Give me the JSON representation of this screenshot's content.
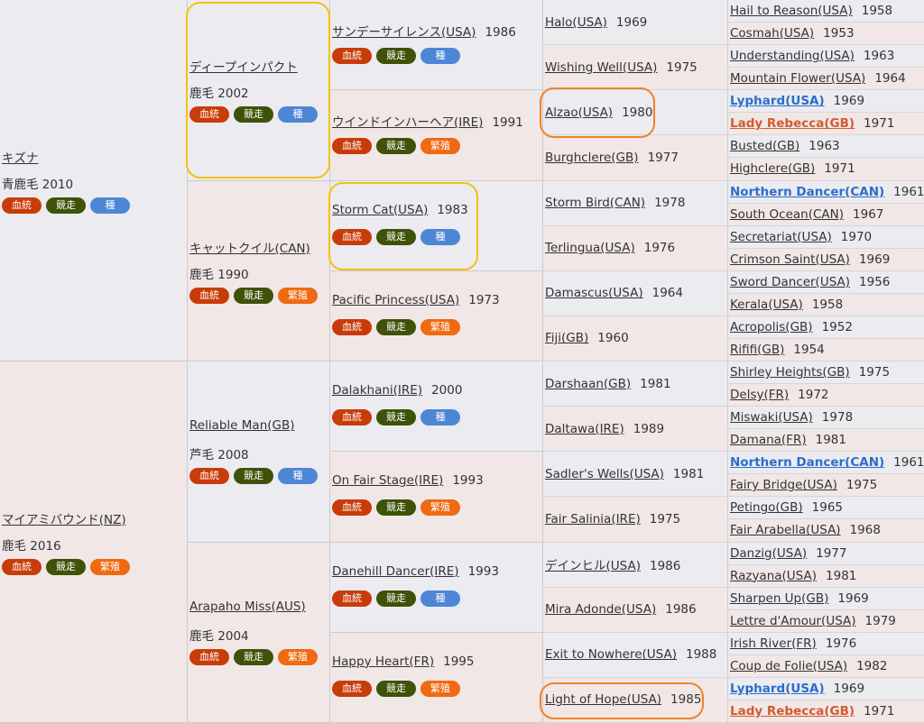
{
  "badge_labels": {
    "blood": "血統",
    "race": "競走",
    "sire": "種",
    "breed": "繁殖"
  },
  "gen1": [
    {
      "name": "キズナ",
      "coat": "青鹿毛 2010",
      "badges": [
        "blood",
        "race",
        "sire"
      ],
      "sex": "male"
    },
    {
      "name": "マイアミバウンド(NZ)",
      "coat": "鹿毛 2016",
      "badges": [
        "blood",
        "race",
        "breed"
      ],
      "sex": "female"
    }
  ],
  "gen2": [
    {
      "name": "ディープインパクト",
      "coat": "鹿毛 2002",
      "badges": [
        "blood",
        "race",
        "sire"
      ],
      "sex": "male"
    },
    {
      "name": "キャットクイル(CAN)",
      "coat": "鹿毛 1990",
      "badges": [
        "blood",
        "race",
        "breed"
      ],
      "sex": "female"
    },
    {
      "name": "Reliable Man(GB)",
      "coat": "芦毛 2008",
      "badges": [
        "blood",
        "race",
        "sire"
      ],
      "sex": "male"
    },
    {
      "name": "Arapaho Miss(AUS)",
      "coat": "鹿毛 2004",
      "badges": [
        "blood",
        "race",
        "breed"
      ],
      "sex": "female"
    }
  ],
  "gen3": [
    {
      "name": "サンデーサイレンス(USA)",
      "year": "1986",
      "badges": [
        "blood",
        "race",
        "sire"
      ],
      "sex": "male"
    },
    {
      "name": "ウインドインハーヘア(IRE)",
      "year": "1991",
      "badges": [
        "blood",
        "race",
        "breed"
      ],
      "sex": "female"
    },
    {
      "name": "Storm Cat(USA)",
      "year": "1983",
      "badges": [
        "blood",
        "race",
        "sire"
      ],
      "sex": "male"
    },
    {
      "name": "Pacific Princess(USA)",
      "year": "1973",
      "badges": [
        "blood",
        "race",
        "breed"
      ],
      "sex": "female"
    },
    {
      "name": "Dalakhani(IRE)",
      "year": "2000",
      "badges": [
        "blood",
        "race",
        "sire"
      ],
      "sex": "male"
    },
    {
      "name": "On Fair Stage(IRE)",
      "year": "1993",
      "badges": [
        "blood",
        "race",
        "breed"
      ],
      "sex": "female"
    },
    {
      "name": "Danehill Dancer(IRE)",
      "year": "1993",
      "badges": [
        "blood",
        "race",
        "sire"
      ],
      "sex": "male"
    },
    {
      "name": "Happy Heart(FR)",
      "year": "1995",
      "badges": [
        "blood",
        "race",
        "breed"
      ],
      "sex": "female"
    }
  ],
  "gen4": [
    {
      "name": "Halo(USA)",
      "year": "1969",
      "sex": "male"
    },
    {
      "name": "Wishing Well(USA)",
      "year": "1975",
      "sex": "female"
    },
    {
      "name": "Alzao(USA)",
      "year": "1980",
      "sex": "male"
    },
    {
      "name": "Burghclere(GB)",
      "year": "1977",
      "sex": "female"
    },
    {
      "name": "Storm Bird(CAN)",
      "year": "1978",
      "sex": "male"
    },
    {
      "name": "Terlingua(USA)",
      "year": "1976",
      "sex": "female"
    },
    {
      "name": "Damascus(USA)",
      "year": "1964",
      "sex": "male"
    },
    {
      "name": "Fiji(GB)",
      "year": "1960",
      "sex": "female"
    },
    {
      "name": "Darshaan(GB)",
      "year": "1981",
      "sex": "male"
    },
    {
      "name": "Daltawa(IRE)",
      "year": "1989",
      "sex": "female"
    },
    {
      "name": "Sadler's Wells(USA)",
      "year": "1981",
      "sex": "male"
    },
    {
      "name": "Fair Salinia(IRE)",
      "year": "1975",
      "sex": "female"
    },
    {
      "name": "デインヒル(USA)",
      "year": "1986",
      "sex": "male"
    },
    {
      "name": "Mira Adonde(USA)",
      "year": "1986",
      "sex": "female"
    },
    {
      "name": "Exit to Nowhere(USA)",
      "year": "1988",
      "sex": "male"
    },
    {
      "name": "Light of Hope(USA)",
      "year": "1985",
      "sex": "female"
    }
  ],
  "gen5": [
    {
      "name": "Hail to Reason(USA)",
      "year": "1958",
      "sex": "male"
    },
    {
      "name": "Cosmah(USA)",
      "year": "1953",
      "sex": "female"
    },
    {
      "name": "Understanding(USA)",
      "year": "1963",
      "sex": "male"
    },
    {
      "name": "Mountain Flower(USA)",
      "year": "1964",
      "sex": "female"
    },
    {
      "name": "Lyphard(USA)",
      "year": "1969",
      "sex": "male",
      "style": "nd"
    },
    {
      "name": "Lady Rebecca(GB)",
      "year": "1971",
      "sex": "female",
      "style": "lr"
    },
    {
      "name": "Busted(GB)",
      "year": "1963",
      "sex": "male"
    },
    {
      "name": "Highclere(GB)",
      "year": "1971",
      "sex": "female"
    },
    {
      "name": "Northern Dancer(CAN)",
      "year": "1961",
      "sex": "male",
      "style": "nd"
    },
    {
      "name": "South Ocean(CAN)",
      "year": "1967",
      "sex": "female"
    },
    {
      "name": "Secretariat(USA)",
      "year": "1970",
      "sex": "male"
    },
    {
      "name": "Crimson Saint(USA)",
      "year": "1969",
      "sex": "female"
    },
    {
      "name": "Sword Dancer(USA)",
      "year": "1956",
      "sex": "male"
    },
    {
      "name": "Kerala(USA)",
      "year": "1958",
      "sex": "female"
    },
    {
      "name": "Acropolis(GB)",
      "year": "1952",
      "sex": "male"
    },
    {
      "name": "Rififi(GB)",
      "year": "1954",
      "sex": "female"
    },
    {
      "name": "Shirley Heights(GB)",
      "year": "1975",
      "sex": "male"
    },
    {
      "name": "Delsy(FR)",
      "year": "1972",
      "sex": "female"
    },
    {
      "name": "Miswaki(USA)",
      "year": "1978",
      "sex": "male"
    },
    {
      "name": "Damana(FR)",
      "year": "1981",
      "sex": "female"
    },
    {
      "name": "Northern Dancer(CAN)",
      "year": "1961",
      "sex": "male",
      "style": "nd"
    },
    {
      "name": "Fairy Bridge(USA)",
      "year": "1975",
      "sex": "female"
    },
    {
      "name": "Petingo(GB)",
      "year": "1965",
      "sex": "male"
    },
    {
      "name": "Fair Arabella(USA)",
      "year": "1968",
      "sex": "female"
    },
    {
      "name": "Danzig(USA)",
      "year": "1977",
      "sex": "male"
    },
    {
      "name": "Razyana(USA)",
      "year": "1981",
      "sex": "female"
    },
    {
      "name": "Sharpen Up(GB)",
      "year": "1969",
      "sex": "male"
    },
    {
      "name": "Lettre d'Amour(USA)",
      "year": "1979",
      "sex": "female"
    },
    {
      "name": "Irish River(FR)",
      "year": "1976",
      "sex": "male"
    },
    {
      "name": "Coup de Folie(USA)",
      "year": "1982",
      "sex": "female"
    },
    {
      "name": "Lyphard(USA)",
      "year": "1969",
      "sex": "male",
      "style": "nd"
    },
    {
      "name": "Lady Rebecca(GB)",
      "year": "1971",
      "sex": "female",
      "style": "lr"
    }
  ]
}
